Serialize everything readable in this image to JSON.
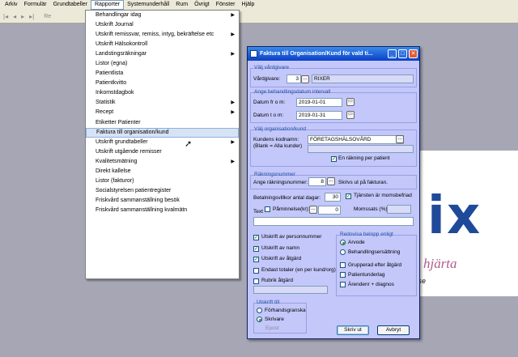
{
  "menubar": {
    "items": [
      "Arkiv",
      "Formulär",
      "Grundtabeller",
      "Rapporter",
      "Systemunderhåll",
      "Rum",
      "Övrigt",
      "Fönster",
      "Hjälp"
    ],
    "active_index": 3
  },
  "toolbar": {
    "partial_label": "Re"
  },
  "dropdown": {
    "items": [
      {
        "label": "Behandlingar idag",
        "submenu": true
      },
      {
        "label": "Utskrift Journal",
        "submenu": false
      },
      {
        "label": "Utskrift remissvar, remiss, intyg, bekräftelse etc",
        "submenu": true
      },
      {
        "label": "Utskrift Hälsokontroll",
        "submenu": false
      },
      {
        "label": "Landstingsräkningar",
        "submenu": true
      },
      {
        "label": "Listor (egna)",
        "submenu": false
      },
      {
        "label": "Patientlista",
        "submenu": false
      },
      {
        "label": "Patientkvitto",
        "submenu": false
      },
      {
        "label": "Inkomstdagbok",
        "submenu": false
      },
      {
        "label": "Statistik",
        "submenu": true
      },
      {
        "label": "Recept",
        "submenu": true
      },
      {
        "label": "Etiketter Patienter",
        "submenu": false
      },
      {
        "label": "Faktura till organisation/kund",
        "submenu": false
      },
      {
        "label": "Utskrift grundtabeller",
        "submenu": true
      },
      {
        "label": "Utskrift utgående remisser",
        "submenu": false
      },
      {
        "label": "Kvalitetsmätning",
        "submenu": true
      },
      {
        "label": "Direkt kallelse",
        "submenu": false
      },
      {
        "label": "Listor (fakturor)",
        "submenu": false
      },
      {
        "label": "Socialstyrelsen patientregister",
        "submenu": false
      },
      {
        "label": "Friskvård sammanställning besök",
        "submenu": false
      },
      {
        "label": "Friskvård sammanställning kvalmätn",
        "submenu": false
      }
    ],
    "highlighted_index": 12
  },
  "background": {
    "logo": "ix",
    "tagline": "l hjärta",
    "sub": "se"
  },
  "dialog": {
    "title": "Faktura till Organisation/Kund för vald ti...",
    "vardgivare": {
      "group": "Välj vårdgivare",
      "label": "Vårdgivare:",
      "id": "3",
      "name": "RIXER"
    },
    "datum": {
      "group": "Ange behandlingsdatum intervall",
      "from_label": "Datum fr o m:",
      "from": "2019-01-01",
      "to_label": "Datum t o m:",
      "to": "2019-01-31"
    },
    "org": {
      "group": "Välj organisation/kund",
      "kod_label": "Kundens kodnamn:",
      "kod_note": "(Blank = Alla kunder)",
      "kod": "FÖRETAGSHÄLSOVÅRD",
      "per_patient": "En räkning per patient"
    },
    "rakning": {
      "group": "Räkningsnummer",
      "label": "Ange räkningsnummer:",
      "value": "8",
      "note": "Skrivs ut på fakturan."
    },
    "villkor": {
      "label": "Betalningsvillkor antal dagar:",
      "value": "30",
      "moms_label": "Tjänsten är momsbefriad"
    },
    "paminnelse": {
      "label": "Påminnelse(kr):",
      "value": "0",
      "momssats_label": "Momssats (%):"
    },
    "text_label": "Text",
    "options": [
      {
        "label": "Utskrift av personnummer",
        "checked": true
      },
      {
        "label": "Utskrift av namn",
        "checked": true
      },
      {
        "label": "Utskrift av åtgärd",
        "checked": true
      },
      {
        "label": "Endast totaler (en per kund/org)",
        "checked": false
      },
      {
        "label": "Rubrik åtgärd",
        "checked": false
      }
    ],
    "redovisa": {
      "group": "Redovisa belopp enligt",
      "radios": [
        {
          "label": "Arvode",
          "on": true
        },
        {
          "label": "Behandlingsersättning",
          "on": false
        }
      ],
      "checks": [
        {
          "label": "Grupperad efter åtgärd"
        },
        {
          "label": "Patientunderlag"
        },
        {
          "label": "Ärendenr + diagnos"
        }
      ]
    },
    "utskrift": {
      "group": "Utskrift till",
      "radios": [
        {
          "label": "Förhandsgranska",
          "on": false
        },
        {
          "label": "Skrivare",
          "on": true
        }
      ],
      "epost": "Epost"
    },
    "buttons": {
      "print": "Skriv ut",
      "cancel": "Avbryt"
    }
  },
  "colors": {
    "desktop": "#a6a6b4",
    "dialog": "#c3c7fa",
    "titlebar": "#0a3fc8",
    "highlight": "#d7e3f5"
  }
}
